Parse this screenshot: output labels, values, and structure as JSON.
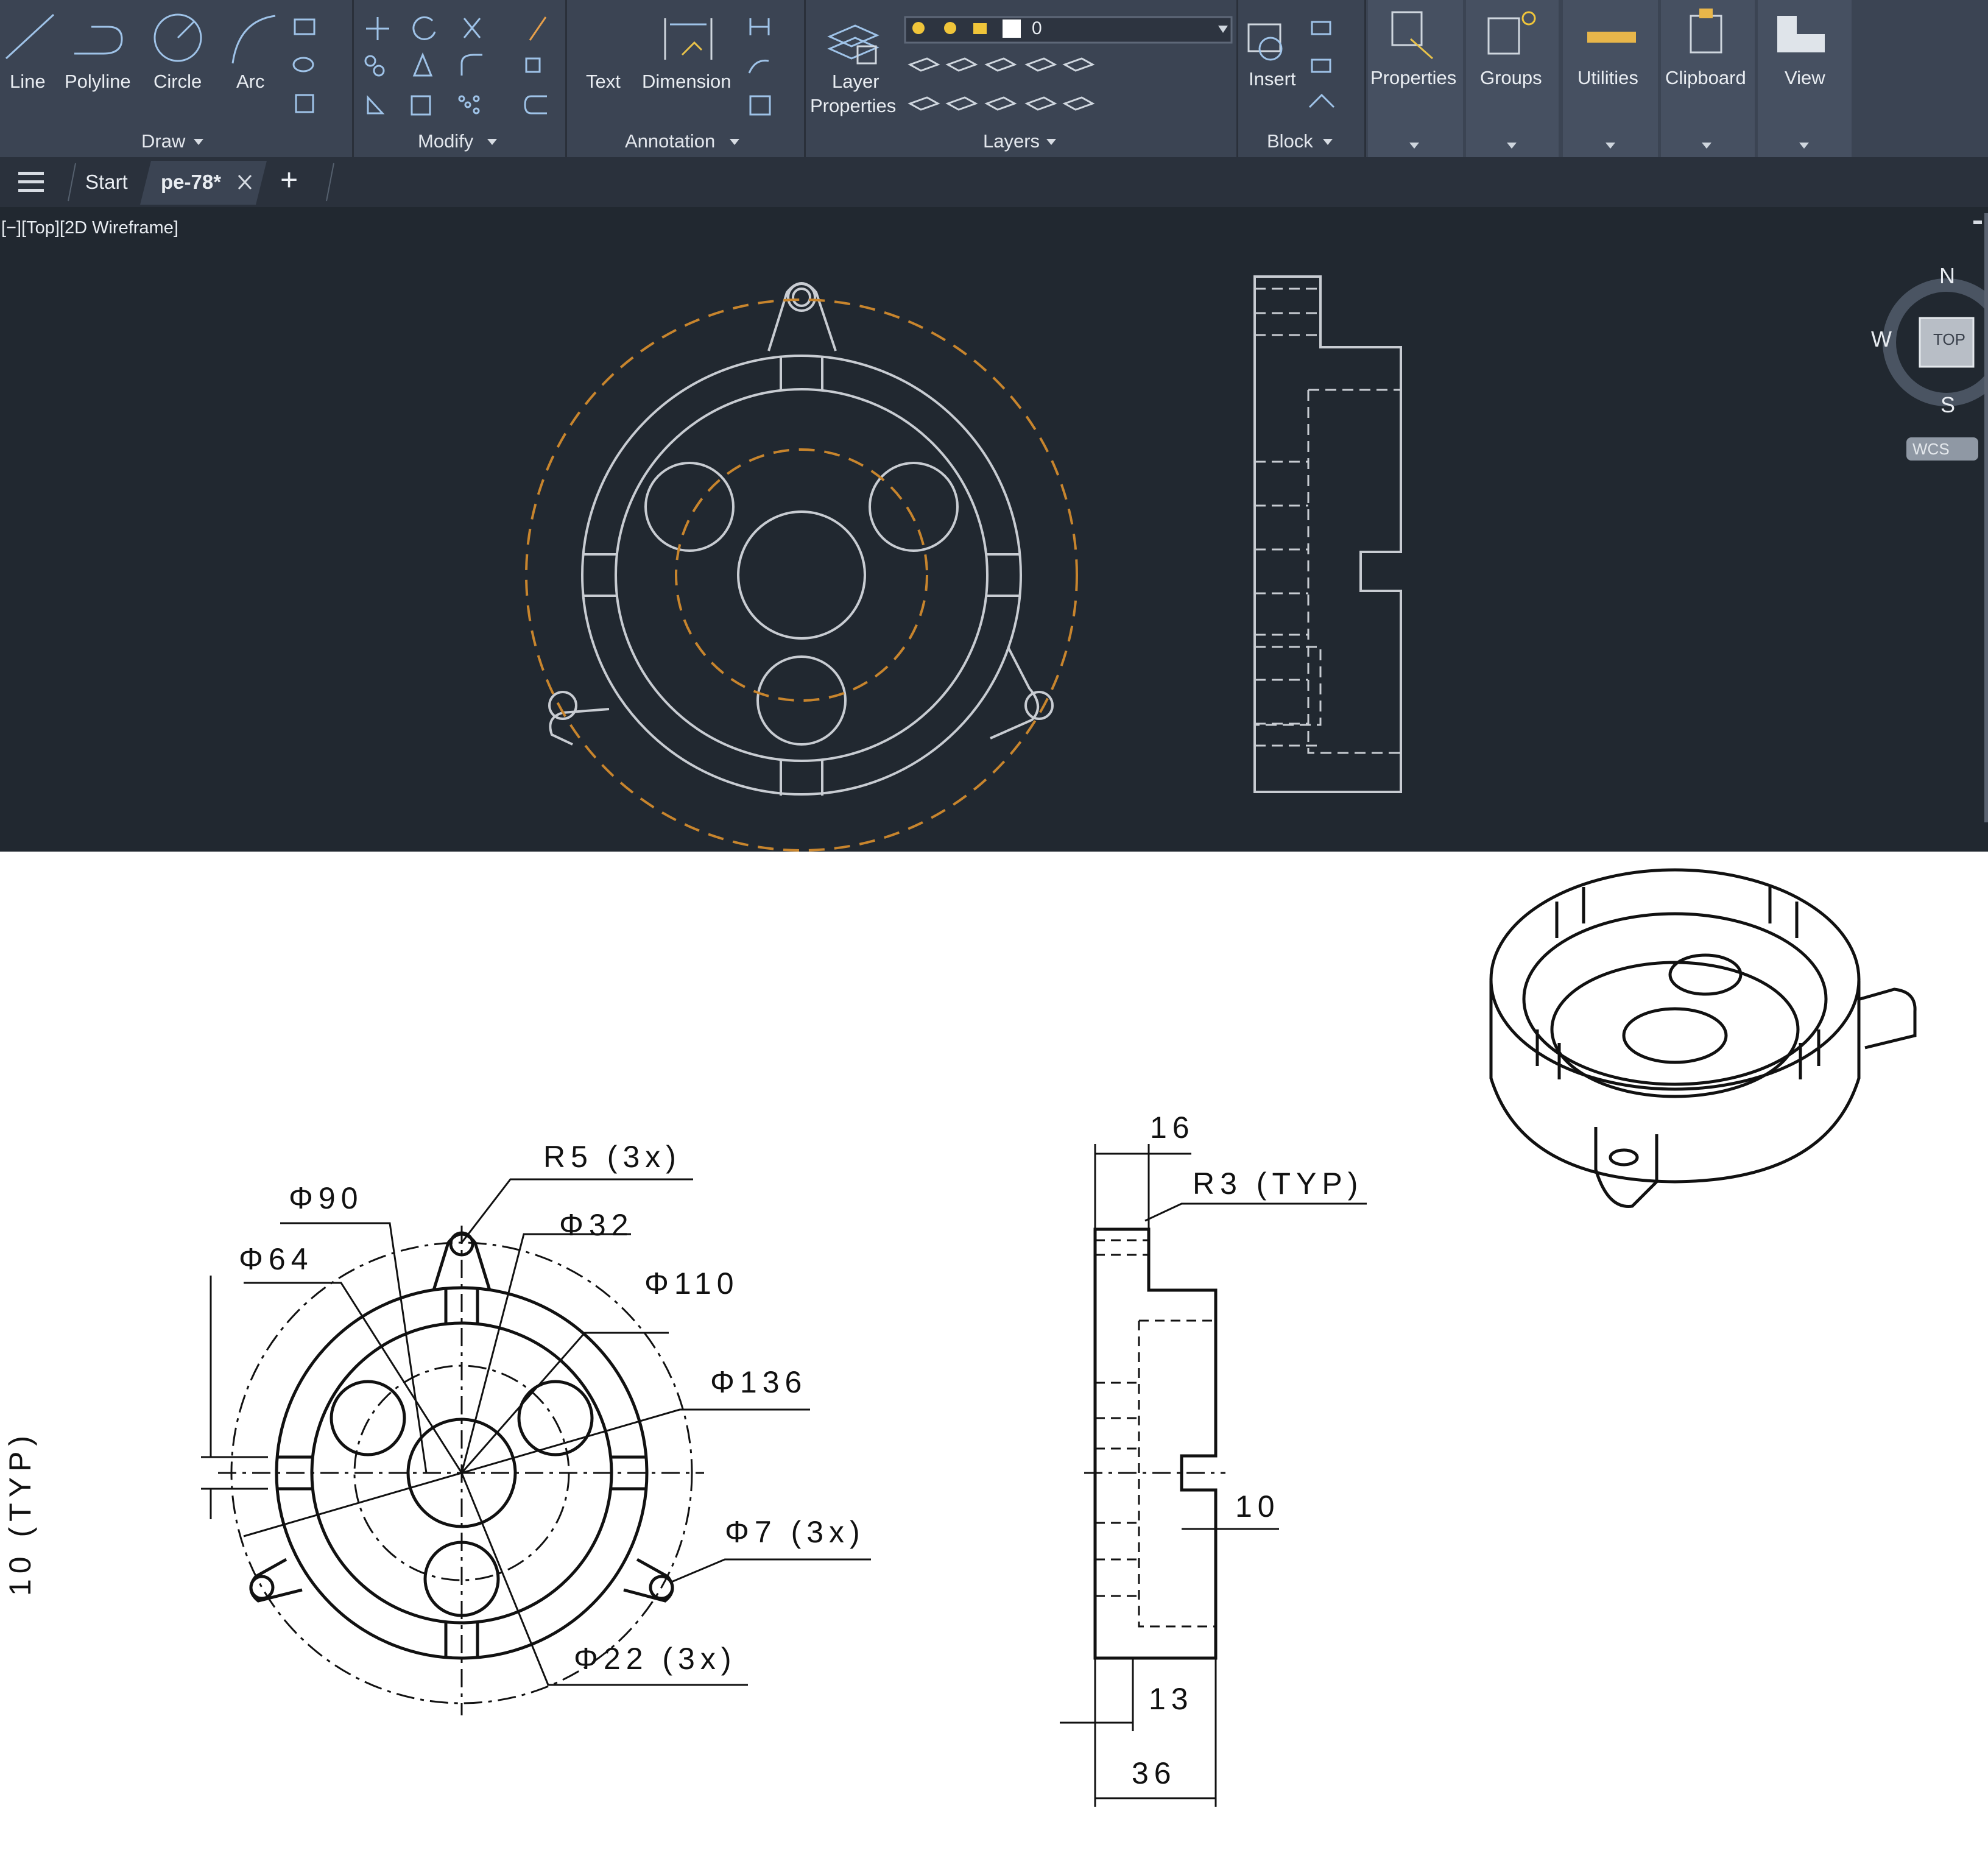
{
  "ribbon": {
    "draw_tools": [
      "Line",
      "Polyline",
      "Circle",
      "Arc"
    ],
    "annotation_tools": [
      "Text",
      "Dimension"
    ],
    "layer_properties": [
      "Layer",
      "Properties"
    ],
    "layer_current": "0",
    "insert": "Insert",
    "panels": [
      "Properties",
      "Groups",
      "Utilities",
      "Clipboard",
      "View"
    ],
    "groups": [
      "Draw",
      "Modify",
      "Annotation",
      "Layers",
      "Block"
    ]
  },
  "tabs": {
    "start": "Start",
    "active": "pe-78*",
    "add": "+"
  },
  "viewport": {
    "label": "[−][Top][2D Wireframe]",
    "viewcube": {
      "north": "N",
      "south": "S",
      "west": "W",
      "face": "TOP",
      "wcs": "WCS"
    }
  },
  "drawing": {
    "front_dims": [
      "R5 (3x)",
      "Φ90",
      "Φ32",
      "Φ64",
      "Φ110",
      "Φ136",
      "Φ7 (3x)",
      "Φ22 (3x)",
      "10 (TYP)"
    ],
    "side_dims": [
      "16",
      "R3 (TYP)",
      "10",
      "13",
      "36"
    ]
  },
  "colors": {
    "ribbon": "#3b4453",
    "canvas": "#212830",
    "wire": "#c8ccd2",
    "accent": "#c8852d"
  }
}
